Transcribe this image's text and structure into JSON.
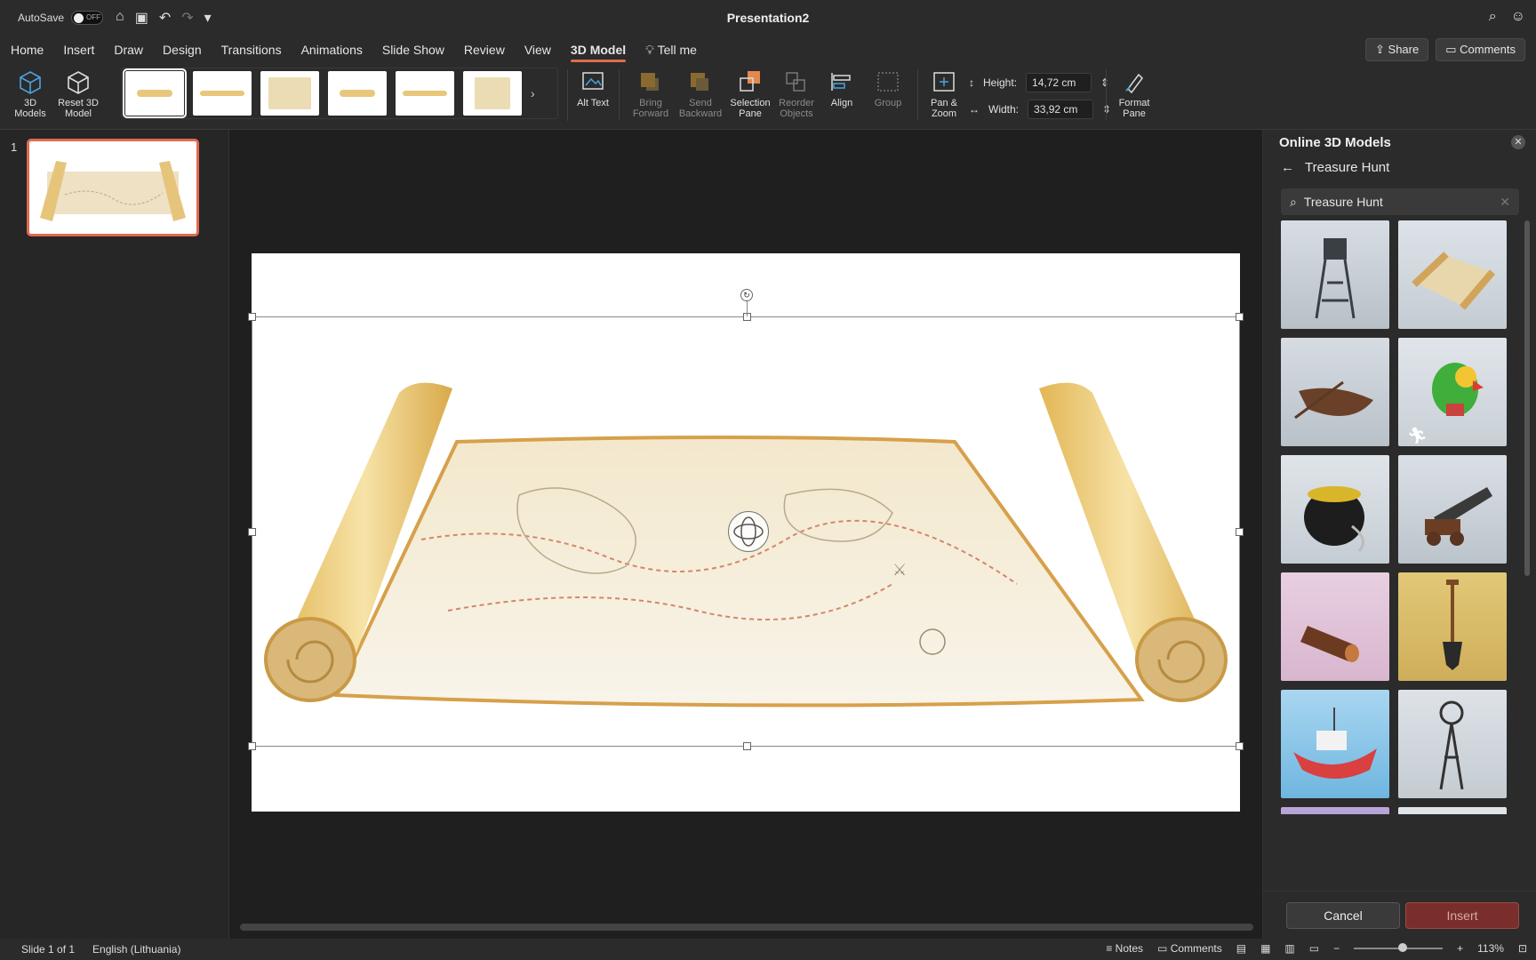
{
  "titlebar": {
    "autosave_label": "AutoSave",
    "autosave_state": "OFF",
    "document_title": "Presentation2"
  },
  "tabs": [
    {
      "label": "Home"
    },
    {
      "label": "Insert"
    },
    {
      "label": "Draw"
    },
    {
      "label": "Design"
    },
    {
      "label": "Transitions"
    },
    {
      "label": "Animations"
    },
    {
      "label": "Slide Show"
    },
    {
      "label": "Review"
    },
    {
      "label": "View"
    },
    {
      "label": "3D Model"
    }
  ],
  "tell_me": "Tell me",
  "share_label": "Share",
  "comments_label": "Comments",
  "ribbon": {
    "models_3d": "3D Models",
    "reset_3d": "Reset 3D Model",
    "alt_text": "Alt Text",
    "bring_forward": "Bring Forward",
    "send_backward": "Send Backward",
    "selection_pane": "Selection Pane",
    "reorder_objects": "Reorder Objects",
    "align": "Align",
    "group": "Group",
    "pan_zoom": "Pan & Zoom",
    "height_label": "Height:",
    "height_value": "14,72 cm",
    "width_label": "Width:",
    "width_value": "33,92 cm",
    "format_pane": "Format Pane"
  },
  "slide_number": "1",
  "panel": {
    "title": "Online 3D Models",
    "category": "Treasure Hunt",
    "search_value": "Treasure Hunt",
    "cancel": "Cancel",
    "insert": "Insert"
  },
  "status": {
    "slide_info": "Slide 1 of 1",
    "language": "English (Lithuania)",
    "notes": "Notes",
    "comments": "Comments",
    "zoom": "113%"
  },
  "colors": {
    "accent": "#e3694f",
    "insert_button": "#7a2e2b"
  }
}
